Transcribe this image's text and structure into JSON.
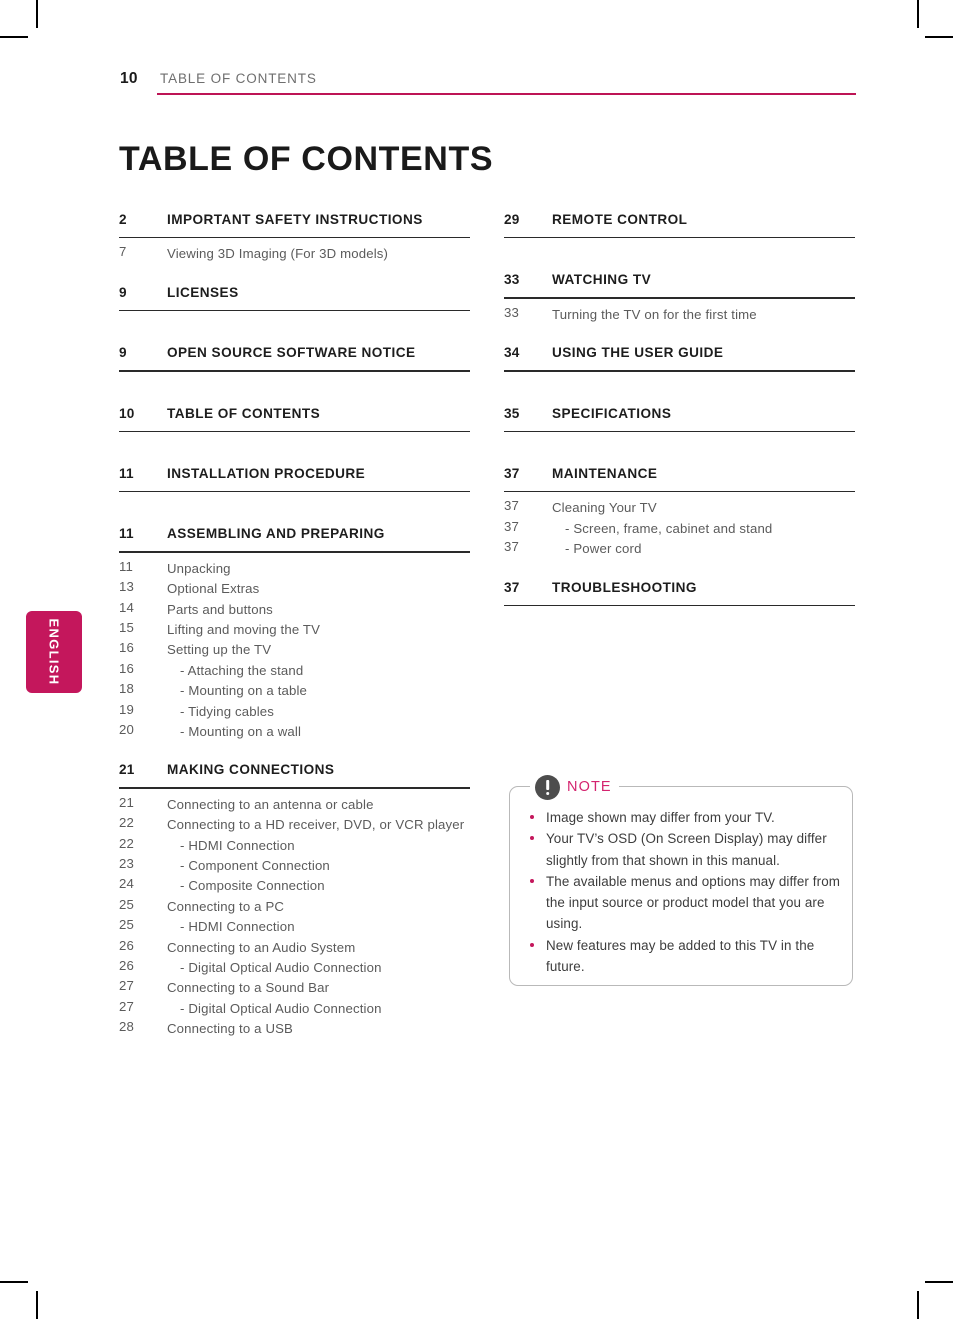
{
  "colors": {
    "accent": "#c4175c",
    "header_rule": "#bd1455",
    "note_title": "#d4246f",
    "section_rule": "#2a2a2a",
    "body_text": "#5b5b5b"
  },
  "header": {
    "page_number": "10",
    "running_title": "TABLE OF CONTENTS"
  },
  "title": "TABLE OF CONTENTS",
  "language_tab": {
    "label": "ENGLISH"
  },
  "left_column": {
    "sections": [
      {
        "num": "2",
        "label": "IMPORTANT SAFETY INSTRUCTIONS",
        "items": [
          {
            "num": "7",
            "text": "Viewing 3D Imaging (For 3D models)",
            "indent": false
          }
        ]
      },
      {
        "num": "9",
        "label": "LICENSES",
        "items": []
      },
      {
        "num": "9",
        "label": "OPEN SOURCE SOFTWARE NOTICE",
        "items": []
      },
      {
        "num": "10",
        "label": "TABLE OF CONTENTS",
        "items": []
      },
      {
        "num": "11",
        "label": "INSTALLATION PROCEDURE",
        "items": []
      },
      {
        "num": "11",
        "label": "ASSEMBLING AND PREPARING",
        "items": [
          {
            "num": "11",
            "text": "Unpacking",
            "indent": false
          },
          {
            "num": "13",
            "text": "Optional Extras",
            "indent": false
          },
          {
            "num": "14",
            "text": "Parts and buttons",
            "indent": false
          },
          {
            "num": "15",
            "text": "Lifting and moving the TV",
            "indent": false
          },
          {
            "num": "16",
            "text": "Setting up the TV",
            "indent": false
          },
          {
            "num": "16",
            "text": "- Attaching the stand",
            "indent": true
          },
          {
            "num": "18",
            "text": "- Mounting on a table",
            "indent": true
          },
          {
            "num": "19",
            "text": "- Tidying cables",
            "indent": true
          },
          {
            "num": "20",
            "text": "- Mounting on a wall",
            "indent": true
          }
        ]
      },
      {
        "num": "21",
        "label": "MAKING CONNECTIONS",
        "items": [
          {
            "num": "21",
            "text": "Connecting to an antenna or cable",
            "indent": false
          },
          {
            "num": "22",
            "text": "Connecting to a HD receiver, DVD, or VCR player",
            "indent": false
          },
          {
            "num": "22",
            "text": "- HDMI Connection",
            "indent": true
          },
          {
            "num": "23",
            "text": "- Component Connection",
            "indent": true
          },
          {
            "num": "24",
            "text": "- Composite Connection",
            "indent": true
          },
          {
            "num": "25",
            "text": "Connecting to a PC",
            "indent": false
          },
          {
            "num": "25",
            "text": "- HDMI Connection",
            "indent": true
          },
          {
            "num": "26",
            "text": "Connecting to an Audio System",
            "indent": false
          },
          {
            "num": "26",
            "text": "- Digital Optical Audio Connection",
            "indent": true
          },
          {
            "num": "27",
            "text": "Connecting to a Sound Bar",
            "indent": false
          },
          {
            "num": "27",
            "text": "- Digital Optical Audio Connection",
            "indent": true
          },
          {
            "num": "28",
            "text": "Connecting to a USB",
            "indent": false
          }
        ]
      }
    ]
  },
  "right_column": {
    "sections": [
      {
        "num": "29",
        "label": "REMOTE CONTROL",
        "items": []
      },
      {
        "num": "33",
        "label": "WATCHING TV",
        "items": [
          {
            "num": "33",
            "text": "Turning the TV on for the first time",
            "indent": false
          }
        ]
      },
      {
        "num": "34",
        "label": "USING THE USER GUIDE",
        "items": []
      },
      {
        "num": "35",
        "label": "SPECIFICATIONS",
        "items": []
      },
      {
        "num": "37",
        "label": "MAINTENANCE",
        "items": [
          {
            "num": "37",
            "text": "Cleaning Your TV",
            "indent": false
          },
          {
            "num": "37",
            "text": "- Screen, frame, cabinet and stand",
            "indent": true
          },
          {
            "num": "37",
            "text": "- Power cord",
            "indent": true
          }
        ]
      },
      {
        "num": "37",
        "label": "TROUBLESHOOTING",
        "items": []
      }
    ]
  },
  "note": {
    "title": "NOTE",
    "items": [
      "Image shown may differ from your TV.",
      "Your TV’s OSD (On Screen Display) may differ slightly from that shown in this manual.",
      "The available menus and options may differ from the input source or product model that you are using.",
      "New features may be added to this TV in the future."
    ]
  }
}
